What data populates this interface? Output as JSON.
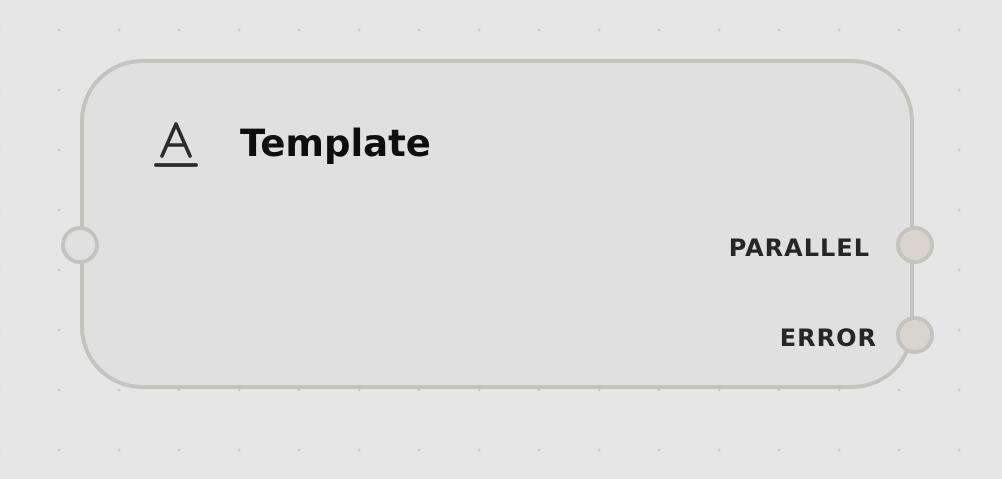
{
  "node": {
    "title": "Template",
    "icon": "template-text-icon",
    "ports": {
      "input": {
        "name": "input-port"
      },
      "outputs": [
        {
          "label": "PARALLEL"
        },
        {
          "label": "ERROR"
        }
      ]
    }
  },
  "colors": {
    "canvas_background": "#e6e6e6",
    "canvas_dots": "#c9c9c9",
    "node_fill": "#e0e0e0",
    "node_border": "#c4c4bf",
    "output_port_fill": "#d9d4ce",
    "title_text": "#0e0e0e",
    "port_label_text": "#262626"
  }
}
